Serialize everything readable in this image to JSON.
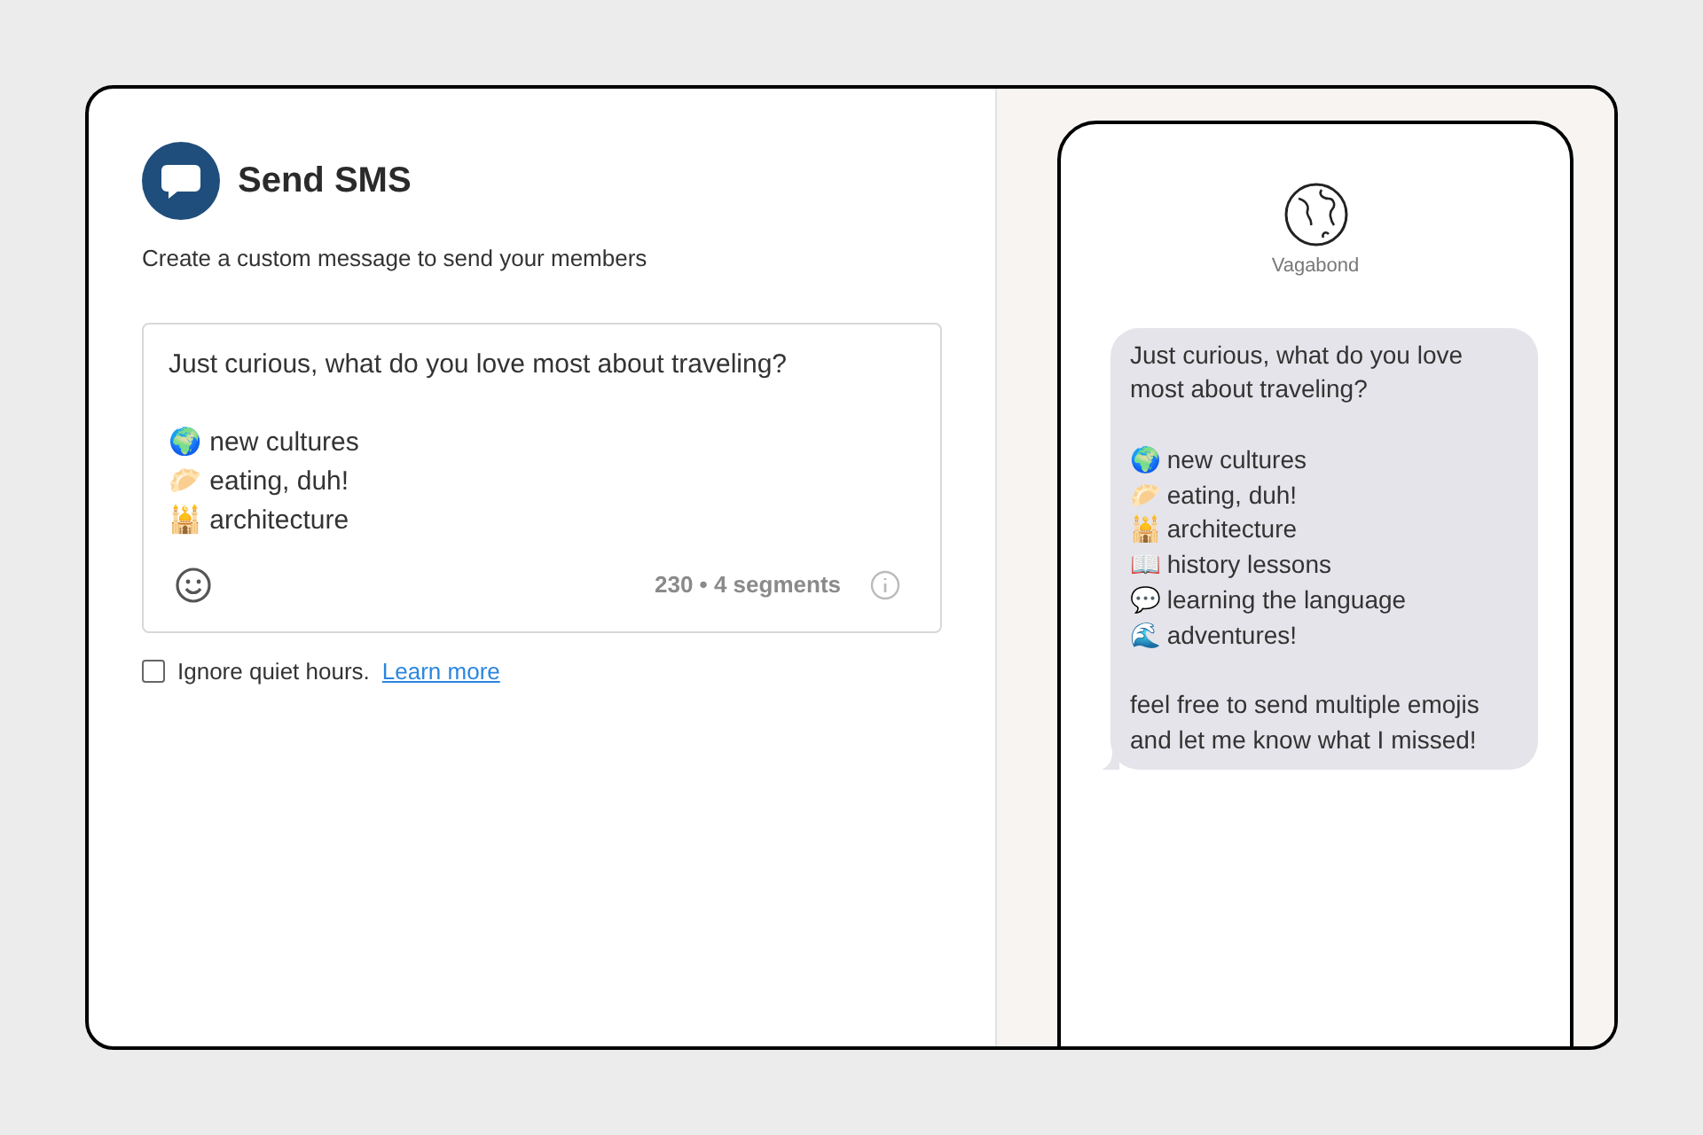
{
  "header": {
    "title": "Send SMS",
    "subtitle": "Create a custom message to send your members"
  },
  "message_field": {
    "paragraphs": [
      [
        "Just curious, what do you love most about traveling?"
      ],
      [
        "🌍 new cultures",
        "🥟 eating, duh!",
        "🕌 architecture"
      ]
    ],
    "counter": "230 • 4 segments"
  },
  "quiet_hours": {
    "label": "Ignore quiet hours.",
    "checked": false,
    "link": "Learn more"
  },
  "preview": {
    "sender": "Vagabond",
    "bubble_paragraphs": [
      [
        "Just curious, what do you love",
        "most about traveling?"
      ],
      [
        "🌍 new cultures",
        "🥟 eating, duh!",
        "🕌 architecture",
        "📖 history lessons",
        "💬 learning the language",
        "🌊 adventures!"
      ],
      [
        "feel free to send multiple emojis",
        "and let me know what I missed!"
      ]
    ]
  }
}
